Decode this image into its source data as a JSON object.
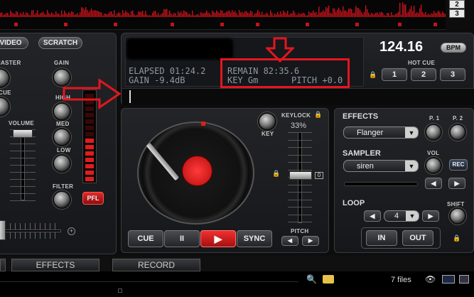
{
  "waveform": {
    "deck_tabs": [
      "2",
      "3"
    ],
    "color": "#c5121b"
  },
  "mixer": {
    "top_buttons": {
      "video": "VIDEO",
      "scratch": "SCRATCH"
    },
    "left_labels": {
      "master": "MASTER",
      "cue": "CUE",
      "volume": "VOLUME"
    },
    "eq_labels": {
      "gain": "GAIN",
      "high": "HIGH",
      "med": "MED",
      "low": "LOW",
      "filter": "FILTER"
    },
    "pfl": "PFL"
  },
  "deck": {
    "bpm_value": "124.16",
    "bpm_label": "BPM",
    "elapsed": "ELAPSED 01:24.2",
    "gain": "GAIN -9.4dB",
    "remain": "REMAIN 82:35.6",
    "key": "KEY Gm",
    "pitch_readout": "PITCH +0.0",
    "hot_cue_label": "HOT CUE",
    "hot_cues": [
      "1",
      "2",
      "3"
    ],
    "key_knob_label": "KEY",
    "keylock_label": "KEYLOCK",
    "keylock_value": "33%",
    "pitch_label": "PITCH",
    "transport": {
      "cue": "CUE",
      "pause": "II",
      "play": "▶",
      "sync": "SYNC"
    }
  },
  "effects": {
    "title": "EFFECTS",
    "p1": "P. 1",
    "p2": "P. 2",
    "selected": "Flanger"
  },
  "sampler": {
    "title": "SAMPLER",
    "vol_label": "VOL",
    "selected": "siren",
    "rec": "REC"
  },
  "loop": {
    "title": "LOOP",
    "shift_label": "SHIFT",
    "value": "4",
    "in": "IN",
    "out": "OUT"
  },
  "bottom_tabs": {
    "effects": "EFFECTS",
    "record": "RECORD"
  },
  "browser": {
    "file_count": "7 files"
  },
  "colors": {
    "accent_red": "#e21c1c",
    "annotation_red": "#e3161f"
  }
}
